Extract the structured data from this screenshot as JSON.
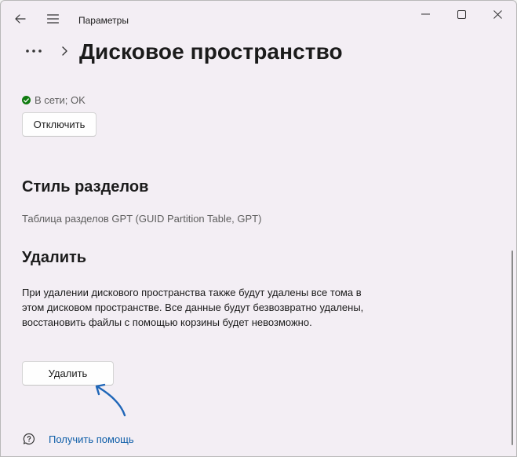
{
  "titlebar": {
    "title": "Параметры",
    "back_icon": "back-arrow-icon",
    "menu_icon": "hamburger-menu-icon",
    "window_controls": [
      "minimize-icon",
      "maximize-icon",
      "close-icon"
    ]
  },
  "header": {
    "more_icon": "more-dots-icon",
    "chevron_icon": "chevron-right-icon",
    "page_title": "Дисковое пространство"
  },
  "status": {
    "text": "В сети; OK",
    "color": "#0f7b0f"
  },
  "buttons": {
    "disconnect": "Отключить",
    "delete": "Удалить"
  },
  "partition_style": {
    "title": "Стиль разделов",
    "value": "Таблица разделов GPT (GUID Partition Table, GPT)"
  },
  "delete_section": {
    "title": "Удалить",
    "description": "При удалении дискового пространства также будут удалены все тома в этом дисковом пространстве. Все данные будут безвозвратно удалены, восстановить файлы с помощью корзины будет невозможно."
  },
  "help": {
    "link_text": "Получить помощь",
    "icon": "help-chat-icon"
  },
  "colors": {
    "accent_link": "#0e5ea8",
    "annotation_arrow": "#1f66b8",
    "background": "#f3eef4"
  }
}
